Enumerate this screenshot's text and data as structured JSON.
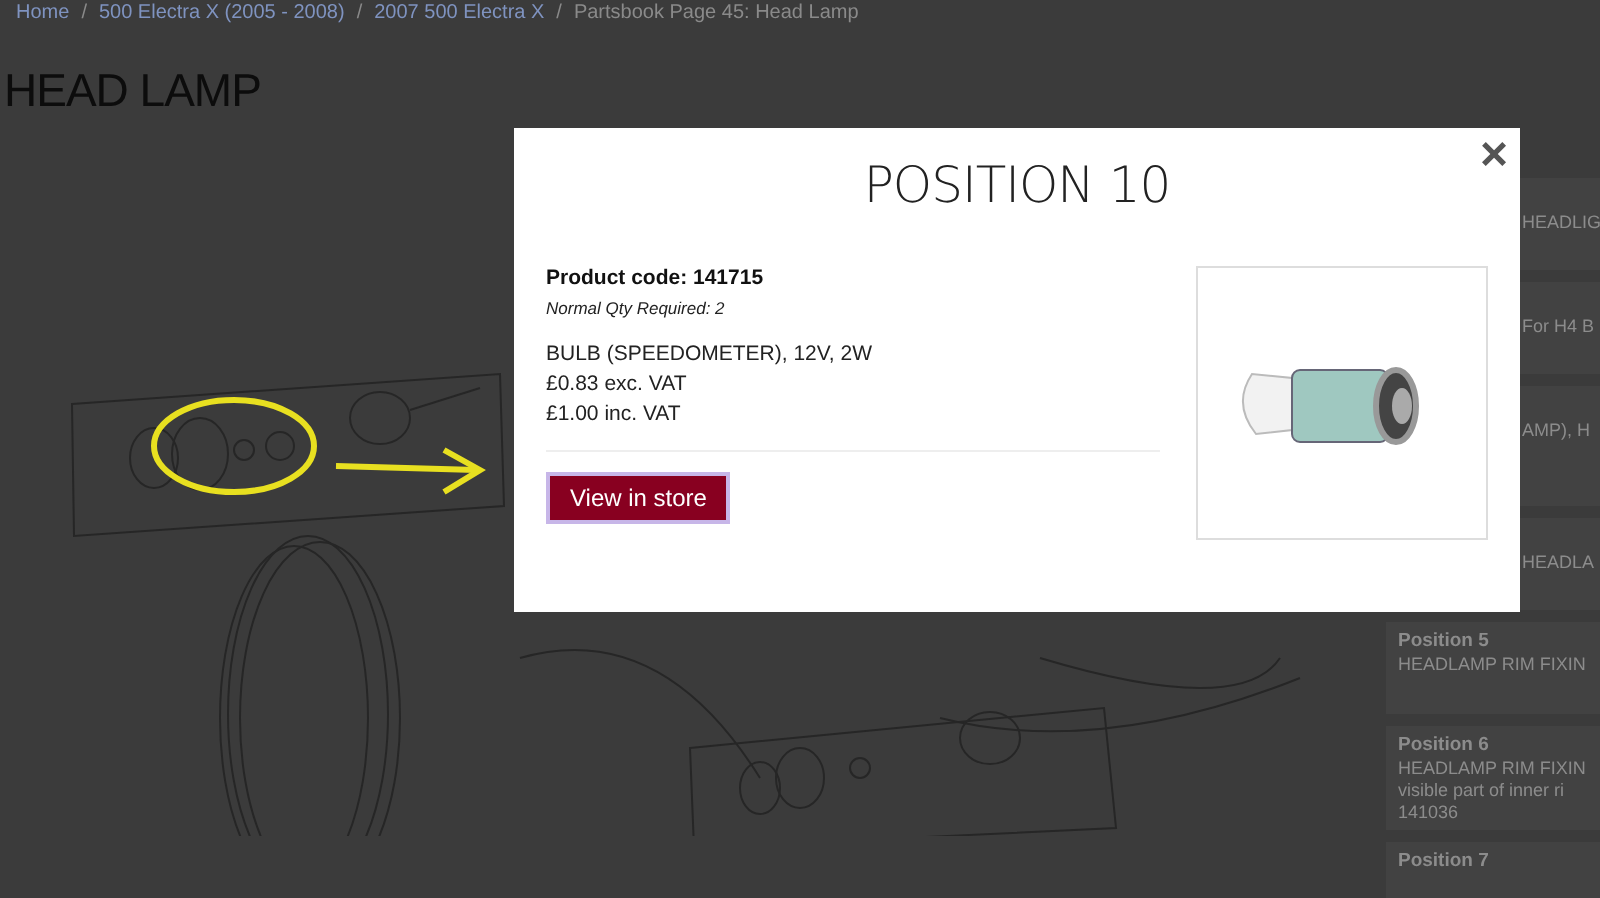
{
  "breadcrumb": [
    {
      "label": "Home",
      "kind": "link"
    },
    {
      "label": "/",
      "kind": "separator"
    },
    {
      "label": "500 Electra X (2005 - 2008)",
      "kind": "link"
    },
    {
      "label": "/",
      "kind": "separator"
    },
    {
      "label": "2007 500 Electra X",
      "kind": "link"
    },
    {
      "label": "/",
      "kind": "separator"
    },
    {
      "label": "Partsbook Page 45: Head Lamp",
      "kind": "current"
    }
  ],
  "page_title": "HEAD LAMP",
  "parts_list": [
    {
      "kind": "partial",
      "lines": [
        "HEADLIG"
      ]
    },
    {
      "kind": "partial",
      "lines": [
        "For H4 B"
      ]
    },
    {
      "kind": "partial_tall",
      "lines": [
        "AMP), H"
      ]
    },
    {
      "kind": "partial",
      "lines": [
        "HEADLA"
      ]
    },
    {
      "kind": "full",
      "title": "Position 5",
      "lines": [
        "HEADLAMP RIM FIXIN"
      ]
    },
    {
      "kind": "full",
      "title": "Position 6",
      "lines": [
        "HEADLAMP RIM FIXIN",
        "visible part of inner ri",
        "141036"
      ]
    },
    {
      "kind": "full",
      "title": "Position 7"
    }
  ],
  "modal": {
    "title": "POSITION 10",
    "close": "×",
    "product_code": "Product code: 141715",
    "qty": "Normal Qty Required: 2",
    "description": "BULB (SPEEDOMETER), 12V, 2W",
    "price_ex": "£0.83 exc. VAT",
    "price_inc": "£1.00 inc. VAT",
    "button": "View in store"
  }
}
